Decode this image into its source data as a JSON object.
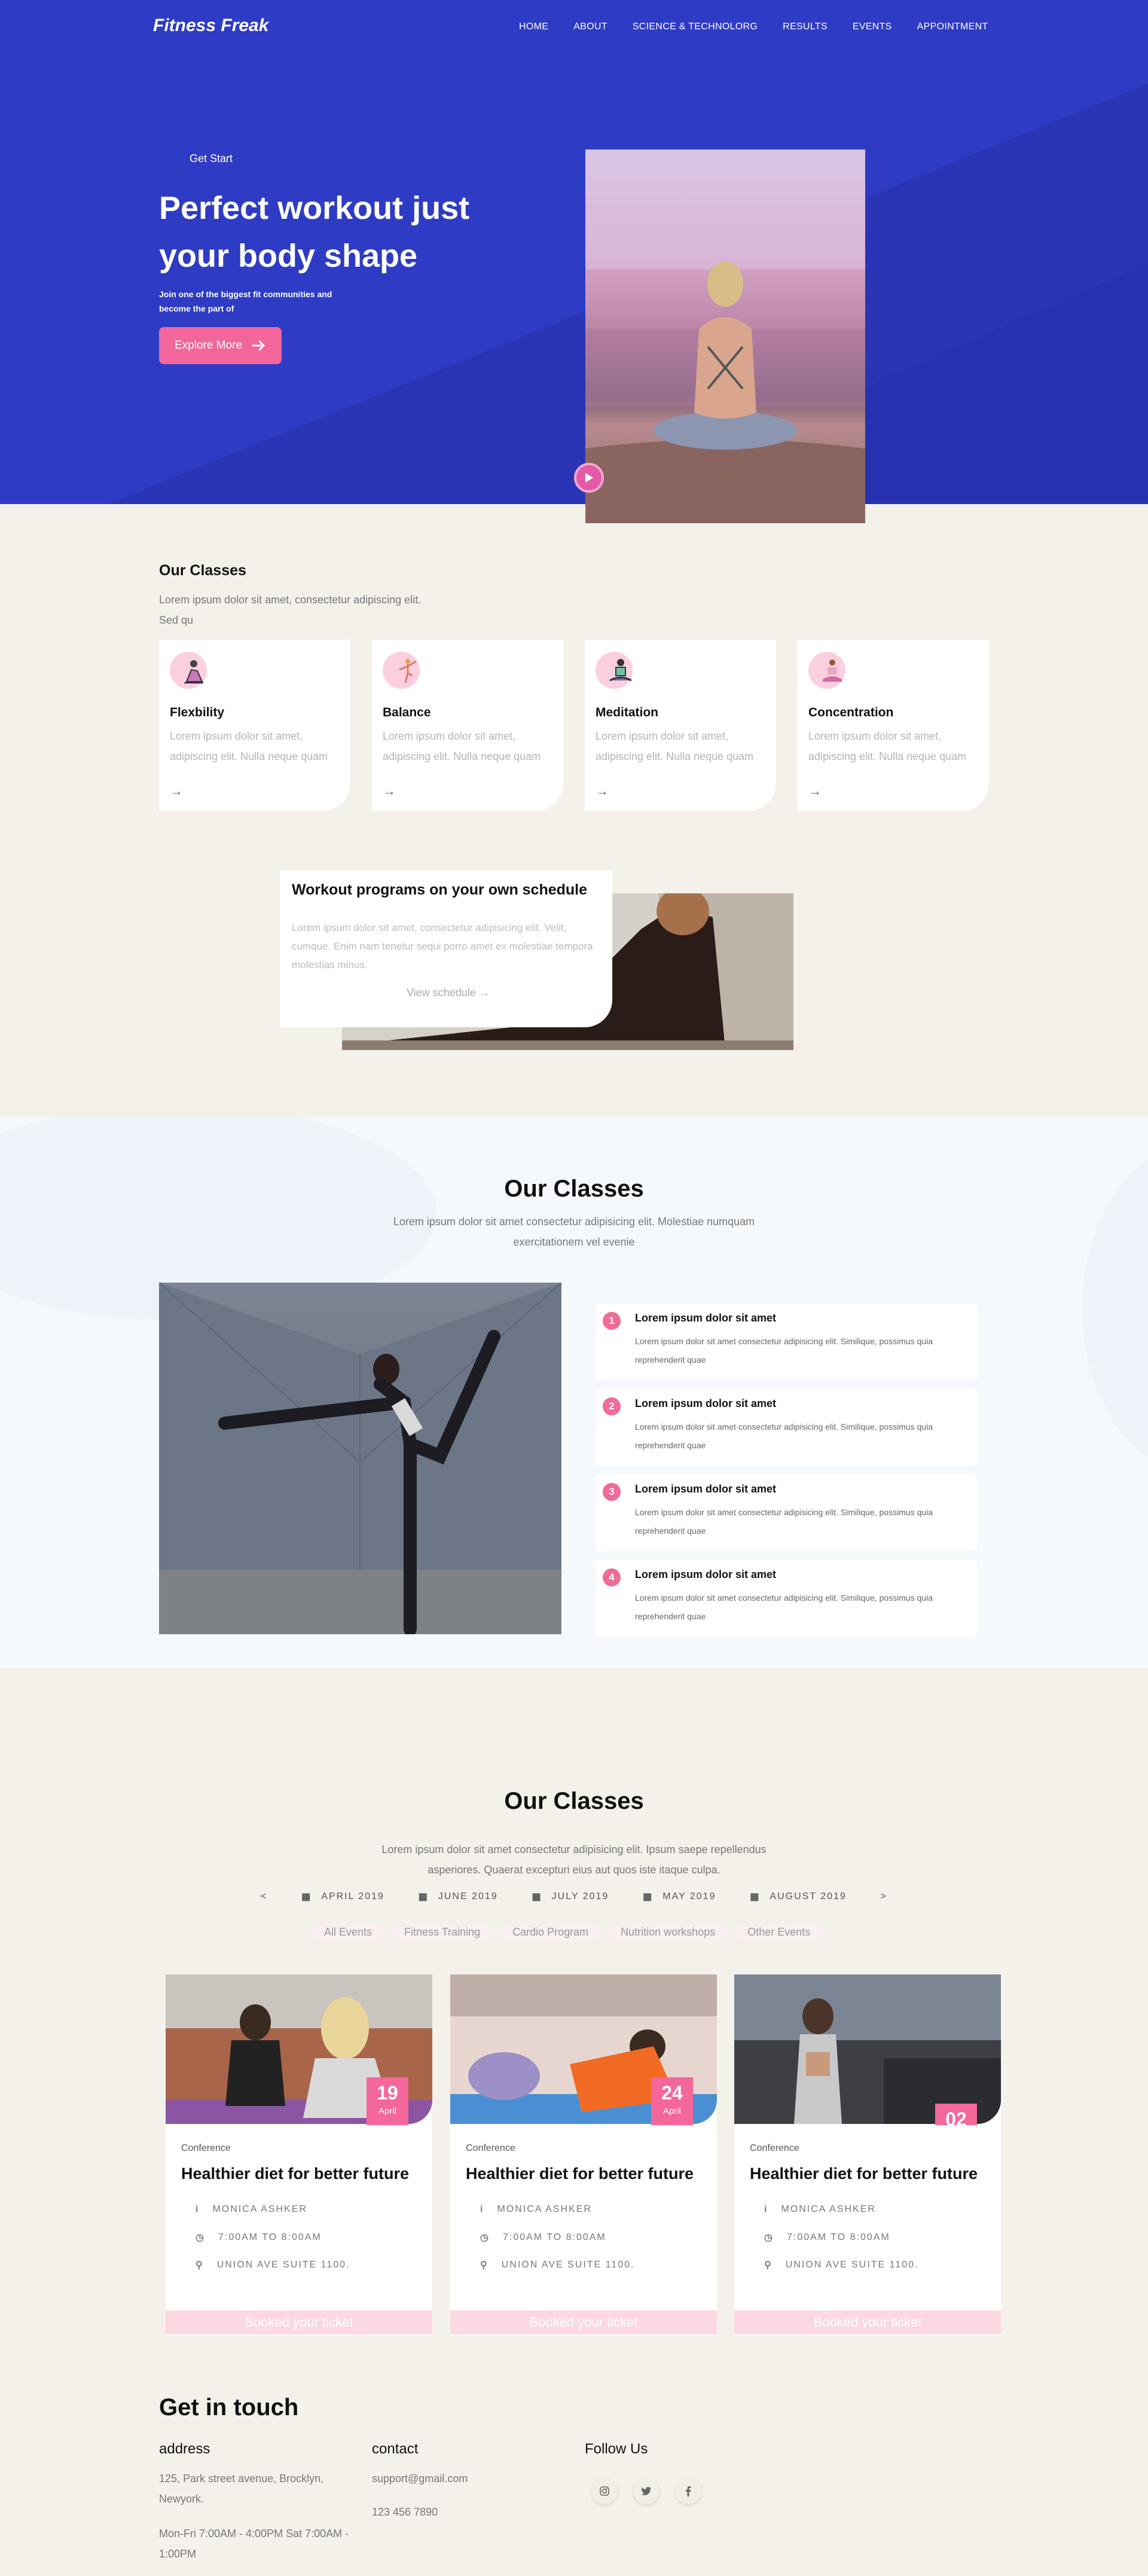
{
  "brand": "Fitness Freak",
  "nav": [
    "HOME",
    "ABOUT",
    "SCIENCE & TECHNOLORG",
    "RESULTS",
    "EVENTS",
    "APPOINTMENT"
  ],
  "hero": {
    "kicker": "Get Start",
    "title": "Perfect workout just your body shape",
    "subtitle": "Join one of the biggest fit communities and become the part of",
    "button": "Explore More"
  },
  "classes": {
    "title": "Our Classes",
    "desc": "Lorem ipsum dolor sit amet, consectetur adipiscing elit. Sed qu",
    "items": [
      {
        "name": "Flexbility",
        "desc": "Lorem ipsum dolor sit amet, adipiscing elit. Nulla neque quam",
        "icon": "flexibility-icon"
      },
      {
        "name": "Balance",
        "desc": "Lorem ipsum dolor sit amet, adipiscing elit. Nulla neque quam",
        "icon": "balance-icon"
      },
      {
        "name": "Meditation",
        "desc": "Lorem ipsum dolor sit amet, adipiscing elit. Nulla neque quam",
        "icon": "meditation-icon"
      },
      {
        "name": "Concentration",
        "desc": "Lorem ipsum dolor sit amet, adipiscing elit. Nulla neque quam",
        "icon": "concentration-icon"
      }
    ]
  },
  "workout": {
    "title": "Workout programs on your own schedule",
    "desc": "Lorem ipsum dolor sit amet, consectetur adipisicing elit. Velit, cumque. Enim nam tenetur sequi porro amet ex molestiae tempora molestias minus.",
    "link": "View schedule"
  },
  "steps_section": {
    "title": "Our Classes",
    "desc": "Lorem ipsum dolor sit amet consectetur adipisicing elit. Molestiae numquam exercitationem vel evenie",
    "steps": [
      {
        "num": "1",
        "title": "Lorem ipsum dolor sit amet",
        "desc": "Lorem ipsum dolor sit amet consectetur adipisicing elit. Similique, possimus quia reprehenderit quae"
      },
      {
        "num": "2",
        "title": "Lorem ipsum dolor sit amet",
        "desc": "Lorem ipsum dolor sit amet consectetur adipisicing elit. Similique, possimus quia reprehenderit quae"
      },
      {
        "num": "3",
        "title": "Lorem ipsum dolor sit amet",
        "desc": "Lorem ipsum dolor sit amet consectetur adipisicing elit. Similique, possimus quia reprehenderit quae"
      },
      {
        "num": "4",
        "title": "Lorem ipsum dolor sit amet",
        "desc": "Lorem ipsum dolor sit amet consectetur adipisicing elit. Similique, possimus quia reprehenderit quae"
      }
    ]
  },
  "events": {
    "title": "Our Classes",
    "desc": "Lorem ipsum dolor sit amet consectetur adipisicing elit. Ipsum saepe repellendus asperiores. Quaerat excepturi eius aut quos iste itaque culpa.",
    "prev": "<",
    "next": ">",
    "months": [
      "APRIL 2019",
      "JUNE 2019",
      "JULY 2019",
      "MAY 2019",
      "AUGUST 2019"
    ],
    "categories": [
      "All Events",
      "Fitness Training",
      "Cardio Program",
      "Nutrition workshops",
      "Other Events"
    ],
    "cards": [
      {
        "day": "19",
        "month": "April",
        "tag": "Conference",
        "title": "Healthier diet for better future",
        "person": "MONICA ASHKER",
        "time": "7:00AM TO 8:00AM",
        "place": "UNION AVE SUITE 1100.",
        "button": "Booked your ticket"
      },
      {
        "day": "24",
        "month": "April",
        "tag": "Conference",
        "title": "Healthier diet for better future",
        "person": "MONICA ASHKER",
        "time": "7:00AM TO 8:00AM",
        "place": "UNION AVE SUITE 1100.",
        "button": "Booked your ticket"
      },
      {
        "day": "02",
        "month": "",
        "tag": "Conference",
        "title": "Healthier diet for better future",
        "person": "MONICA ASHKER",
        "time": "7:00AM TO 8:00AM",
        "place": "UNION AVE SUITE 1100.",
        "button": "Booked your ticket"
      }
    ]
  },
  "footer": {
    "title": "Get in touch",
    "address_h": "address",
    "address": "125, Park street avenue, Brocklyn, Newyork.",
    "hours": "Mon-Fri 7:00AM - 4:00PM Sat 7:00AM - 1:00PM",
    "contact_h": "contact",
    "email": "support@gmail.com",
    "phone": "123 456 7890",
    "follow_h": "Follow Us"
  },
  "colors": {
    "hero_blue": "#2e3bc4",
    "accent_pink": "#f2669b",
    "page_bg": "#f4f1ea"
  }
}
